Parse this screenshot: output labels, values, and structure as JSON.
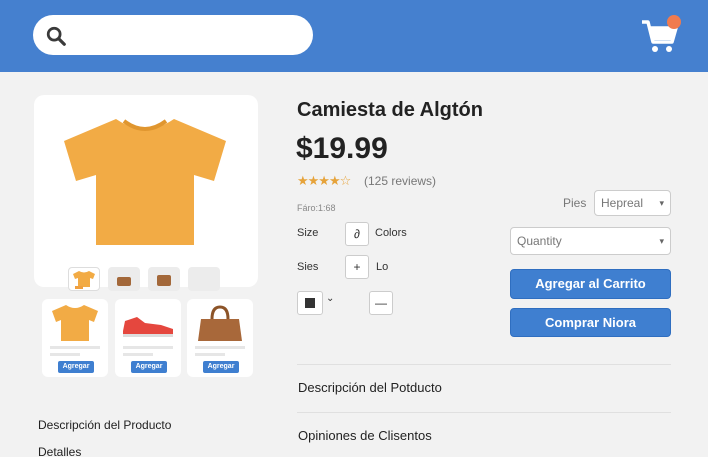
{
  "header": {
    "search": {
      "placeholder": ""
    },
    "cart_badge_color": "#f07b4f",
    "bar_color": "#4580cf"
  },
  "gallery": {
    "main_image": "tshirt-image",
    "thumbnails": [
      "tshirt-thumb",
      "bag-thumb",
      "bag-thumb",
      "empty-thumb"
    ]
  },
  "related": [
    {
      "image": "tshirt-image",
      "button": "Agregar"
    },
    {
      "image": "sneaker-image",
      "button": "Agregar"
    },
    {
      "image": "handbag-image",
      "button": "Agregar"
    }
  ],
  "left_nav": [
    "Descripción del Producto",
    "Detalles"
  ],
  "product": {
    "title": "Camiesta de Algtón",
    "price": "$19.99",
    "rating_stars": "★★★★☆",
    "rating_value": 4.5,
    "reviews": "(125 reviews)",
    "sku": "Fáro:1:68"
  },
  "options": {
    "size_label": "Size",
    "size_icon": "∂",
    "colors_label": "Colors",
    "sizes_label": "Sies",
    "plus": "+",
    "lo_label": "Lo",
    "swatch_chevron": "⌄",
    "minus": "—",
    "pies_label": "Pies",
    "pies_value": "Hepreal",
    "quantity_value": "Quantity"
  },
  "actions": {
    "add_to_cart": "Agregar al Carrito",
    "buy_now": "Comprar Niora"
  },
  "sections": [
    "Descripción del Potducto",
    "Opiniones de Clisentos"
  ],
  "colors": {
    "accent": "#3f7fd0",
    "star": "#e6a33a",
    "shirt": "#f2ab45"
  }
}
